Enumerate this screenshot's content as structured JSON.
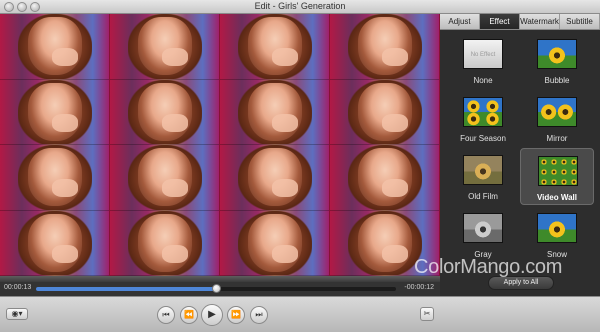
{
  "window": {
    "title": "Edit - Girls' Generation"
  },
  "tabs": [
    {
      "label": "Adjust",
      "active": false
    },
    {
      "label": "Effect",
      "active": true
    },
    {
      "label": "Watermark",
      "active": false
    },
    {
      "label": "Subtitle",
      "active": false
    }
  ],
  "effects": [
    {
      "label": "None",
      "thumb": "none",
      "thumb_text": "No Effect",
      "selected": false
    },
    {
      "label": "Bubble",
      "thumb": "sun",
      "selected": false
    },
    {
      "label": "Four Season",
      "thumb": "sun4",
      "selected": false
    },
    {
      "label": "Mirror",
      "thumb": "sunmirror",
      "selected": false
    },
    {
      "label": "Old Film",
      "thumb": "sunfilm",
      "selected": false
    },
    {
      "label": "Video Wall",
      "thumb": "sunwall",
      "selected": true
    },
    {
      "label": "Gray",
      "thumb": "sungray",
      "selected": false
    },
    {
      "label": "Snow",
      "thumb": "sun",
      "selected": false
    }
  ],
  "playback": {
    "elapsed": "00:00:13",
    "remaining": "-00:00:12",
    "progress_fraction": 0.5
  },
  "apply_button": "Apply to All",
  "watermark_text": "ColorMango.com",
  "controls": {
    "camera_icon": "camera-icon",
    "prev_icon": "skip-start-icon",
    "rewind_icon": "rewind-icon",
    "play_icon": "play-icon",
    "forward_icon": "fast-forward-icon",
    "next_icon": "skip-end-icon",
    "cut_icon": "scissors-icon"
  },
  "colors": {
    "accent": "#4e86d8",
    "panel_bg": "#2d2d2d"
  }
}
